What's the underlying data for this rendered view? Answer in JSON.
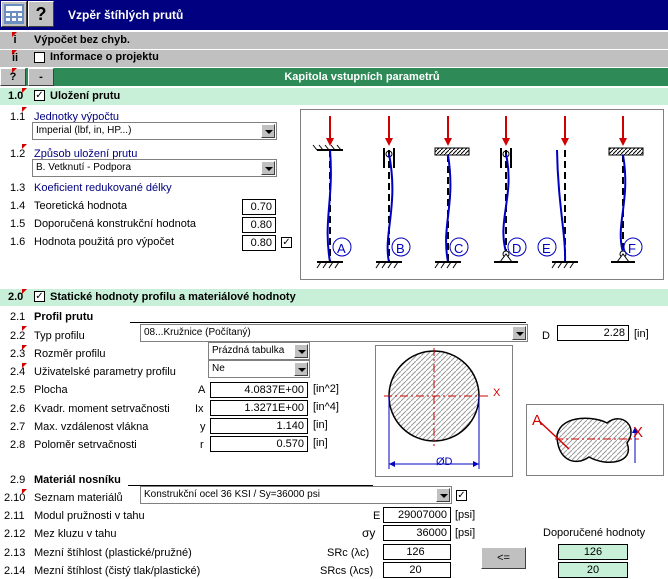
{
  "window": {
    "title": "Vzpěr štíhlých prutů",
    "help_glyph": "?"
  },
  "rows": {
    "r_i": {
      "num": "i",
      "text": "Výpočet bez chyb."
    },
    "r_ii": {
      "num": "ii",
      "text": "Informace o projektu"
    },
    "chapter": {
      "num": "?",
      "minus": "-",
      "text": "Kapitola vstupních parametrů"
    }
  },
  "section1": {
    "num": "1.0",
    "title": "Uložení prutu",
    "items": [
      {
        "num": "1.1",
        "label": "Jednotky výpočtu"
      },
      {
        "num": "1.2",
        "label": "Způsob uložení prutu"
      },
      {
        "num": "1.3",
        "label": "Koeficient redukované délky"
      },
      {
        "num": "1.4",
        "label": "Teoretická hodnota",
        "value": "0.70"
      },
      {
        "num": "1.5",
        "label": "Doporučená konstrukční hodnota",
        "value": "0.80"
      },
      {
        "num": "1.6",
        "label": "Hodnota použitá pro výpočet",
        "value": "0.80"
      }
    ],
    "units_value": "Imperial (lbf, in, HP...)",
    "support_value": "B. Vetknutí - Podpora",
    "cases": [
      "A",
      "B",
      "C",
      "D",
      "E",
      "F"
    ]
  },
  "section2": {
    "num": "2.0",
    "title": "Statické hodnoty profilu a materiálové hodnoty",
    "items": [
      {
        "num": "2.1",
        "label": "Profil prutu"
      },
      {
        "num": "2.2",
        "label": "Typ profilu"
      },
      {
        "num": "2.3",
        "label": "Rozměr profilu"
      },
      {
        "num": "2.4",
        "label": "Uživatelské parametry profilu"
      },
      {
        "num": "2.5",
        "label": "Plocha",
        "sym": "A",
        "value": "4.0837E+00",
        "unit": "[in^2]"
      },
      {
        "num": "2.6",
        "label": "Kvadr. moment setrvačnosti",
        "sym": "Ix",
        "value": "1.3271E+00",
        "unit": "[in^4]"
      },
      {
        "num": "2.7",
        "label": "Max. vzdálenost vlákna",
        "sym": "y",
        "value": "1.140",
        "unit": "[in]"
      },
      {
        "num": "2.8",
        "label": "Poloměr setrvačnosti",
        "sym": "r",
        "value": "0.570",
        "unit": "[in]"
      }
    ],
    "profile_type": "08...Kružnice  (Počítaný)",
    "profile_size": "Prázdná tabulka",
    "user_params": "Ne",
    "d_label": "D",
    "d_value": "2.28",
    "d_unit": "[in]",
    "circle_x": "X",
    "circle_d": "ØD",
    "shape_a": "A",
    "shape_x": "X"
  },
  "section29": {
    "num": "2.9",
    "title": "Materiál nosníku",
    "items": [
      {
        "num": "2.10",
        "label": "Seznam materiálů"
      },
      {
        "num": "2.11",
        "label": "Modul pružnosti v tahu",
        "sym": "E",
        "value": "29007000",
        "unit": "[psi]"
      },
      {
        "num": "2.12",
        "label": "Mez kluzu v tahu",
        "sym": "σy",
        "value": "36000",
        "unit": "[psi]"
      },
      {
        "num": "2.13",
        "label": "Mezní štíhlost (plastické/pružné)",
        "sym": "SRc (λc)",
        "value": "126",
        "rec": "126"
      },
      {
        "num": "2.14",
        "label": "Mezní štíhlost (čistý tlak/plastické)",
        "sym": "SRcs (λcs)",
        "value": "20",
        "rec": "20"
      }
    ],
    "material": "Konstrukční ocel 36 KSI / Sy=36000 psi",
    "rec_header": "Doporučené hodnoty",
    "copy_button": "<="
  }
}
